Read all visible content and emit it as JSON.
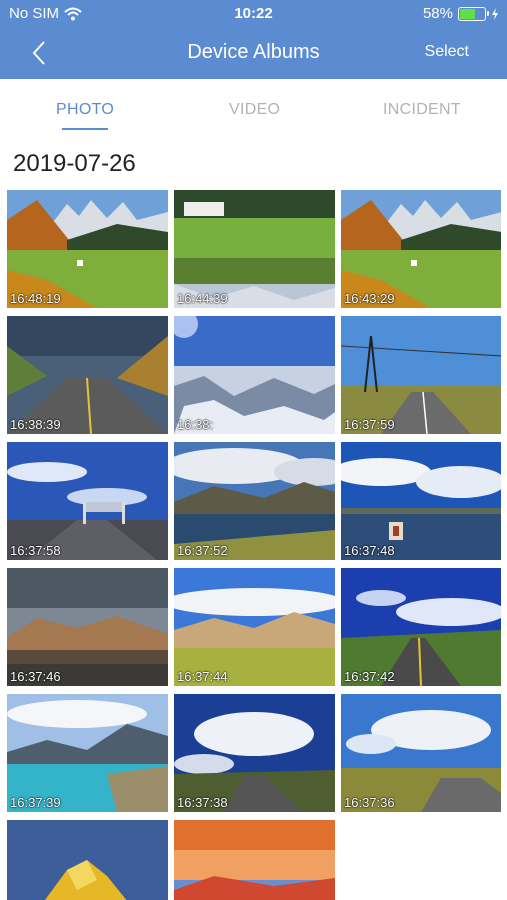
{
  "status": {
    "carrier": "No SIM",
    "time": "10:22",
    "battery": "58%",
    "battery_level": 0.58
  },
  "nav": {
    "title": "Device Albums",
    "select": "Select"
  },
  "tabs": [
    "PHOTO",
    "VIDEO",
    "INCIDENT"
  ],
  "active_tab": "PHOTO",
  "date": "2019-07-26",
  "photos": [
    {
      "time": "16:48:19",
      "scene": "mountain-village"
    },
    {
      "time": "16:44:39",
      "scene": "village-reflection"
    },
    {
      "time": "16:43:29",
      "scene": "mountain-village"
    },
    {
      "time": "16:38:39",
      "scene": "road-storm"
    },
    {
      "time": "16:38:",
      "scene": "aerial-mountains"
    },
    {
      "time": "16:37:59",
      "scene": "road-powerline"
    },
    {
      "time": "16:37:58",
      "scene": "road-gate"
    },
    {
      "time": "16:37:52",
      "scene": "lake-clouds"
    },
    {
      "time": "16:37:48",
      "scene": "lake-yak"
    },
    {
      "time": "16:37:46",
      "scene": "hills-dark"
    },
    {
      "time": "16:37:44",
      "scene": "desert-hills"
    },
    {
      "time": "16:37:42",
      "scene": "road-blue"
    },
    {
      "time": "16:37:39",
      "scene": "turquoise-lake"
    },
    {
      "time": "16:37:38",
      "scene": "road-clouds"
    },
    {
      "time": "16:37:36",
      "scene": "road-plain"
    },
    {
      "time": "",
      "scene": "golden-peak"
    },
    {
      "time": "",
      "scene": "sunset-lake"
    }
  ]
}
